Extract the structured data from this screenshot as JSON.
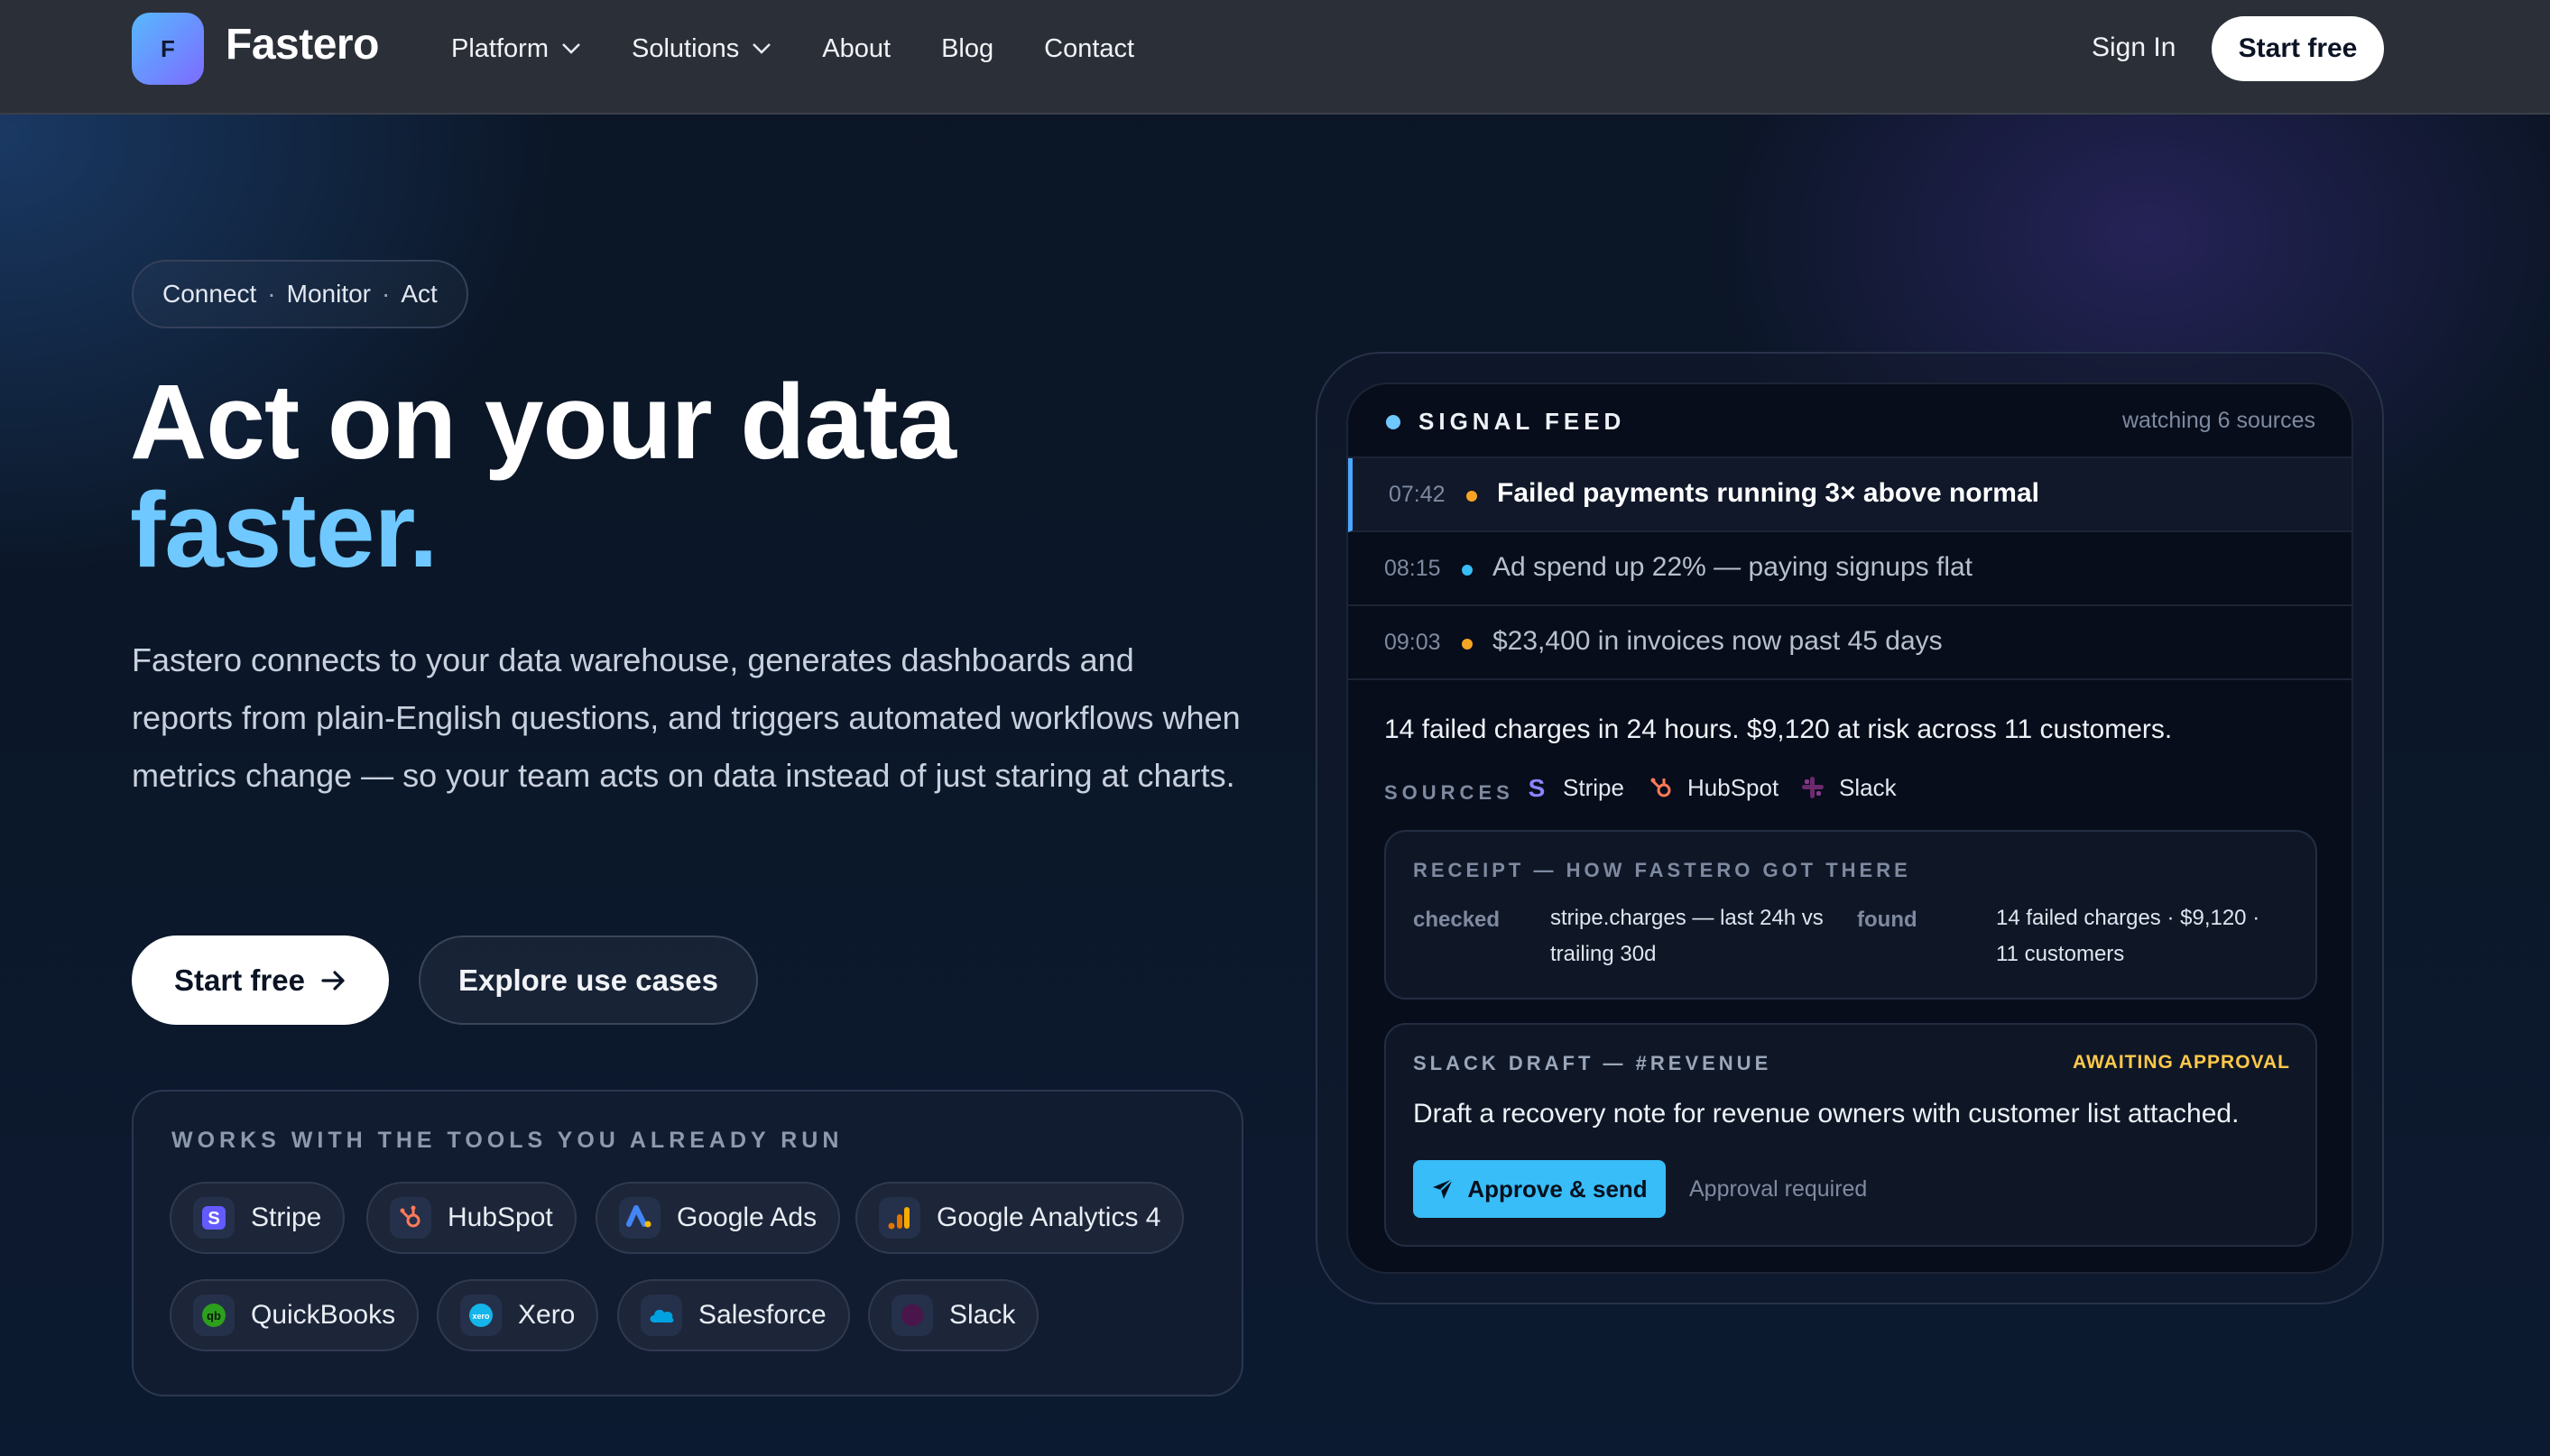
{
  "nav": {
    "logo_letter": "F",
    "brand": "Fastero",
    "links": [
      "Platform",
      "Solutions",
      "About",
      "Blog",
      "Contact"
    ],
    "sign_in": "Sign In",
    "start_free": "Start free"
  },
  "hero": {
    "pill_parts": [
      "Connect",
      "Monitor",
      "Act"
    ],
    "pill_separator": "·",
    "headline_line1": "Act on your data",
    "headline_line2": "faster.",
    "lead": "Fastero connects to your data warehouse, generates dashboards and reports from plain-English questions, and triggers automated workflows when metrics change — so your team acts on data instead of just staring at charts.",
    "primary_cta": "Start free",
    "secondary_cta": "Explore use cases"
  },
  "tools": {
    "title": "WORKS WITH THE TOOLS YOU ALREADY RUN",
    "items": [
      {
        "name": "Stripe",
        "icon": "stripe-icon",
        "color": "#635bff"
      },
      {
        "name": "HubSpot",
        "icon": "hubspot-icon",
        "color": "#ff7a59"
      },
      {
        "name": "Google Ads",
        "icon": "google-ads-icon",
        "color": "#4285f4"
      },
      {
        "name": "Google Analytics 4",
        "icon": "google-analytics-icon",
        "color": "#f9ab00"
      },
      {
        "name": "QuickBooks",
        "icon": "quickbooks-icon",
        "color": "#2ca01c"
      },
      {
        "name": "Xero",
        "icon": "xero-icon",
        "color": "#13b5ea"
      },
      {
        "name": "Salesforce",
        "icon": "salesforce-icon",
        "color": "#00a1e0"
      },
      {
        "name": "Slack",
        "icon": "slack-icon",
        "color": "#4a154b"
      }
    ]
  },
  "feed": {
    "title": "SIGNAL FEED",
    "watching": "watching 6 sources",
    "rows": [
      {
        "time": "07:42",
        "text": "Failed payments running 3× above normal",
        "dot_color": "#f5a524"
      },
      {
        "time": "08:15",
        "text": "Ad spend up 22% — paying signups flat",
        "dot_color": "#38bdf8"
      },
      {
        "time": "09:03",
        "text": "$23,400 in invoices now past 45 days",
        "dot_color": "#f5a524"
      }
    ],
    "summary": "14 failed charges in 24 hours. $9,120 at risk across 11 customers.",
    "sources_label": "SOURCES",
    "sources": [
      {
        "name": "Stripe",
        "icon": "stripe-icon"
      },
      {
        "name": "HubSpot",
        "icon": "hubspot-icon"
      },
      {
        "name": "Slack",
        "icon": "slack-icon"
      }
    ],
    "receipt": {
      "title": "RECEIPT — HOW FASTERO GOT THERE",
      "checked_label": "checked",
      "checked_value_l1": "stripe.charges — last 24h vs",
      "checked_value_l2": "trailing 30d",
      "found_label": "found",
      "found_value_l1": "14 failed charges · $9,120 ·",
      "found_value_l2": "11 customers"
    },
    "draft": {
      "title": "SLACK DRAFT — #REVENUE",
      "status": "AWAITING APPROVAL",
      "text": "Draft a recovery note for revenue owners with customer list attached.",
      "approve_label": "Approve & send",
      "note": "Approval required"
    }
  }
}
